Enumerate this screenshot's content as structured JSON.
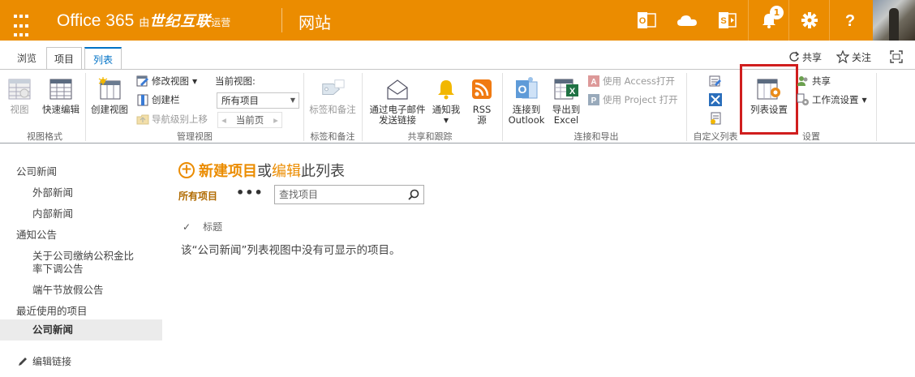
{
  "suite": {
    "brand_main": "Office 365",
    "brand_by": "由",
    "brand_partner": "世纪互联",
    "brand_op": "运营",
    "site_name": "网站",
    "notification_count": "1",
    "accent": "#eb8c00"
  },
  "icons": [
    "app-launcher-icon",
    "outlook-icon",
    "onedrive-icon",
    "sites-icon",
    "bell-icon",
    "gear-icon",
    "help-icon"
  ],
  "tabs": [
    "浏览",
    "项目",
    "列表"
  ],
  "top_actions": {
    "share": "共享",
    "follow": "关注"
  },
  "ribbon": {
    "view_format": {
      "view": "视图",
      "quick_edit": "快速编辑",
      "label": "视图格式"
    },
    "manage_views": {
      "create_view": "创建视图",
      "modify_view": "修改视图",
      "create_column": "创建栏",
      "navigate_up": "导航级别上移",
      "current_view_label": "当前视图:",
      "current_view_value": "所有项目",
      "current_page": "当前页",
      "label": "管理视图"
    },
    "tags": {
      "tags_notes": "标签和备注",
      "label": "标签和备注"
    },
    "share_track": {
      "email_link_line1": "通过电子邮件",
      "email_link_line2": "发送链接",
      "alert_me": "通知我",
      "rss_line1": "RSS",
      "rss_line2": "源",
      "label": "共享和跟踪"
    },
    "connect_export": {
      "outlook_line1": "连接到",
      "outlook_line2": "Outlook",
      "excel_line1": "导出到",
      "excel_line2": "Excel",
      "open_access": "使用 Access打开",
      "open_project": "使用 Project 打开",
      "label": "连接和导出"
    },
    "custom_lists": {
      "label": "自定义列表"
    },
    "settings": {
      "list_settings": "列表设置",
      "share": "共享",
      "workflow_settings": "工作流设置",
      "label": "设置"
    }
  },
  "nav": {
    "items": [
      "公司新闻",
      "外部新闻",
      "内部新闻",
      "通知公告",
      "关于公司缴纳公积金比",
      "率下调公告",
      "端午节放假公告",
      "最近使用的项目",
      "公司新闻"
    ],
    "edit_links": "编辑链接"
  },
  "main": {
    "new_item": "新建项目",
    "or": "或",
    "edit": "编辑",
    "this_list": "此列表",
    "all_items": "所有项目",
    "more": "•••",
    "search_placeholder": "查找项目",
    "column_title": "标题",
    "empty_message": "该“公司新闻”列表视图中没有可显示的项目。"
  }
}
